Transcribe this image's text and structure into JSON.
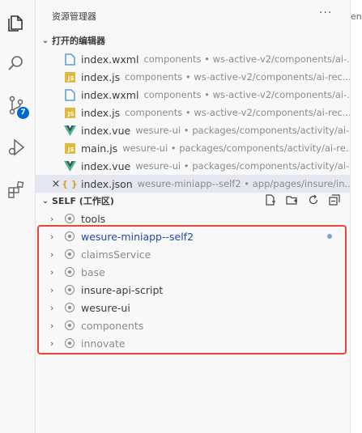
{
  "explorer": {
    "title": "资源管理器",
    "more_label": "···"
  },
  "open_editors": {
    "title": "打开的编辑器",
    "items": [
      {
        "name": "index.wxml",
        "desc": "components • ws-active-v2/components/ai-...",
        "icon": "wxml-file-icon"
      },
      {
        "name": "index.js",
        "desc": "components • ws-active-v2/components/ai-rec...",
        "icon": "js-file-icon"
      },
      {
        "name": "index.wxml",
        "desc": "components • ws-active-v2/components/ai-...",
        "icon": "wxml-file-icon"
      },
      {
        "name": "index.js",
        "desc": "components • ws-active-v2/components/ai-rec...",
        "icon": "js-file-icon"
      },
      {
        "name": "index.vue",
        "desc": "wesure-ui • packages/components/activity/ai-...",
        "icon": "vue-file-icon"
      },
      {
        "name": "main.js",
        "desc": "wesure-ui • packages/components/activity/ai-re...",
        "icon": "js-file-icon"
      },
      {
        "name": "index.vue",
        "desc": "wesure-ui • packages/components/activity/ai-...",
        "icon": "vue-file-icon"
      },
      {
        "name": "index.json",
        "desc": "wesure-miniapp--self2 • app/pages/insure/in...",
        "icon": "json-file-icon"
      }
    ]
  },
  "workspace": {
    "title": "SELF (工作区)",
    "folders": [
      {
        "name": "tools",
        "color": "#3b3b3b"
      },
      {
        "name": "wesure-miniapp--self2",
        "color": "#1f4ba5"
      },
      {
        "name": "claimsService",
        "color": "#8b8b8b"
      },
      {
        "name": "base",
        "color": "#8b8b8b"
      },
      {
        "name": "insure-api-script",
        "color": "#3b3b3b"
      },
      {
        "name": "wesure-ui",
        "color": "#3b3b3b"
      },
      {
        "name": "components",
        "color": "#8b8b8b"
      },
      {
        "name": "innovate",
        "color": "#8b8b8b"
      }
    ]
  },
  "scm": {
    "badge_count": "7"
  },
  "editor": {
    "tab_fragment": "end"
  },
  "colors": {
    "accent": "#0069d1",
    "highlight_border": "#e5473d",
    "selected_bg": "#e4e6f1",
    "js_yellow": "#e0b93f",
    "wxml_blue": "#3c8bd9",
    "vue_green": "#41b883"
  }
}
